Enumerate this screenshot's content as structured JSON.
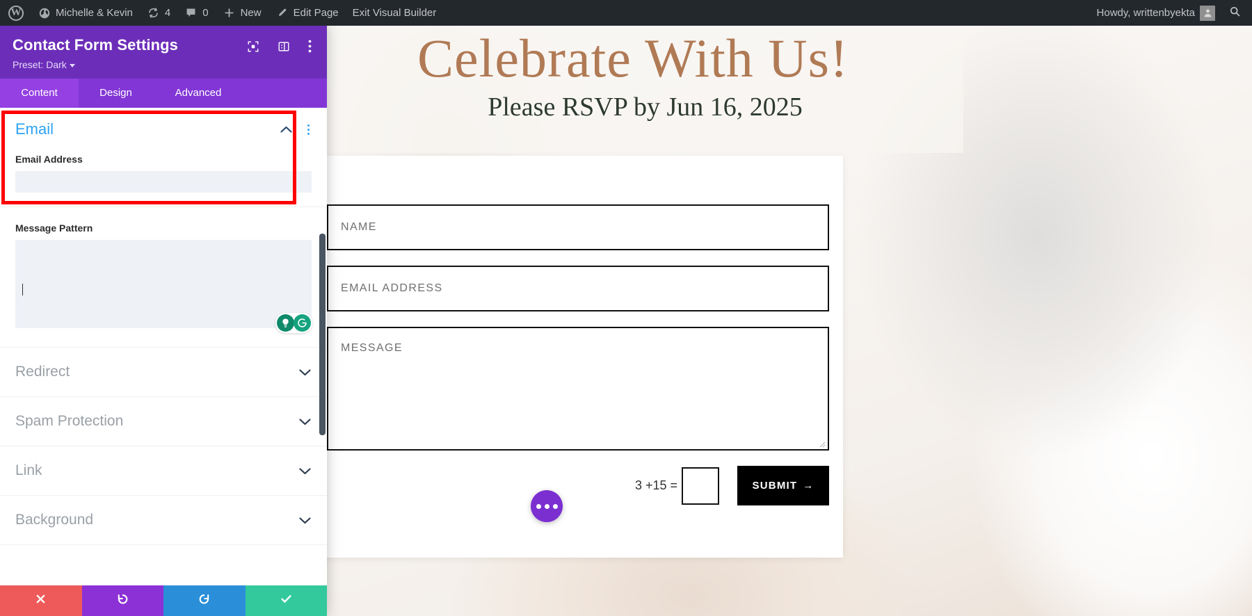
{
  "adminbar": {
    "wp_logo": "wordpress-logo",
    "site_name": "Michelle & Kevin",
    "revisions_count": "4",
    "comments_count": "0",
    "new_label": "New",
    "edit_page_label": "Edit Page",
    "exit_builder_label": "Exit Visual Builder",
    "howdy": "Howdy, writtenbyekta",
    "search_icon": "search-icon",
    "bg_color": "#23282d"
  },
  "settings": {
    "title": "Contact Form Settings",
    "preset_label": "Preset: Dark",
    "header_color": "#6c2eb9",
    "tabs": [
      {
        "label": "Content",
        "active": true
      },
      {
        "label": "Design",
        "active": false
      },
      {
        "label": "Advanced",
        "active": false
      }
    ],
    "email_section": {
      "title": "Email",
      "accent_color": "#2ea3f2",
      "highlighted": true,
      "highlight_color": "#ff0000",
      "fields": [
        {
          "label": "Email Address",
          "value": "",
          "placeholder": "",
          "focused": true
        }
      ]
    },
    "message_pattern": {
      "label": "Message Pattern",
      "value": "",
      "placeholder": "",
      "grammarly": {
        "assist_icon": "grammarly-assist-icon",
        "logo_icon": "grammarly-logo-icon"
      }
    },
    "collapsed_sections": [
      {
        "label": "Redirect"
      },
      {
        "label": "Spam Protection"
      },
      {
        "label": "Link"
      },
      {
        "label": "Background"
      }
    ],
    "footer_buttons": [
      {
        "name": "cancel",
        "icon": "close-icon",
        "color": "#ee5a5a"
      },
      {
        "name": "undo",
        "icon": "undo-icon",
        "color": "#8c31d6"
      },
      {
        "name": "redo",
        "icon": "redo-icon",
        "color": "#2a8fd8"
      },
      {
        "name": "save",
        "icon": "check-icon",
        "color": "#33c99c"
      }
    ]
  },
  "preview": {
    "heading": "Celebrate With Us!",
    "heading_color": "#b07a55",
    "subheading": "Please RSVP by Jun 16, 2025",
    "form": {
      "fields": [
        {
          "label": "NAME",
          "value": ""
        },
        {
          "label": "EMAIL ADDRESS",
          "value": ""
        },
        {
          "label": "MESSAGE",
          "value": ""
        }
      ],
      "captcha_question": "3 +15 =",
      "captcha_value": "",
      "submit_label": "SUBMIT",
      "submit_arrow": "→"
    },
    "fab": {
      "icon": "more-options-icon",
      "color": "#7b2fd1"
    }
  }
}
